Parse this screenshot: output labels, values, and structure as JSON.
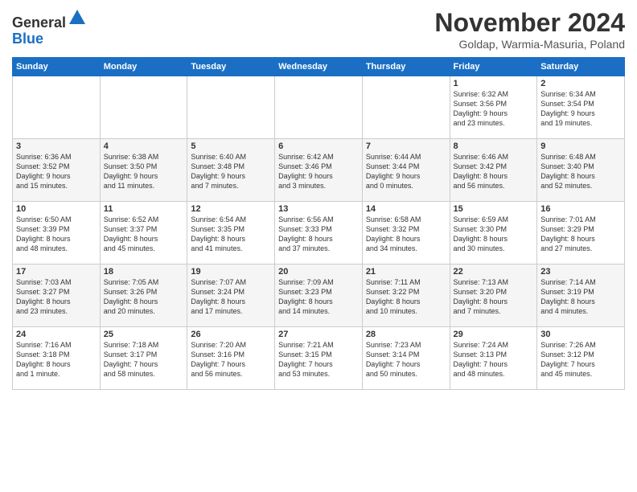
{
  "header": {
    "logo_general": "General",
    "logo_blue": "Blue",
    "title": "November 2024",
    "location": "Goldap, Warmia-Masuria, Poland"
  },
  "weekdays": [
    "Sunday",
    "Monday",
    "Tuesday",
    "Wednesday",
    "Thursday",
    "Friday",
    "Saturday"
  ],
  "weeks": [
    [
      {
        "day": "",
        "info": ""
      },
      {
        "day": "",
        "info": ""
      },
      {
        "day": "",
        "info": ""
      },
      {
        "day": "",
        "info": ""
      },
      {
        "day": "",
        "info": ""
      },
      {
        "day": "1",
        "info": "Sunrise: 6:32 AM\nSunset: 3:56 PM\nDaylight: 9 hours\nand 23 minutes."
      },
      {
        "day": "2",
        "info": "Sunrise: 6:34 AM\nSunset: 3:54 PM\nDaylight: 9 hours\nand 19 minutes."
      }
    ],
    [
      {
        "day": "3",
        "info": "Sunrise: 6:36 AM\nSunset: 3:52 PM\nDaylight: 9 hours\nand 15 minutes."
      },
      {
        "day": "4",
        "info": "Sunrise: 6:38 AM\nSunset: 3:50 PM\nDaylight: 9 hours\nand 11 minutes."
      },
      {
        "day": "5",
        "info": "Sunrise: 6:40 AM\nSunset: 3:48 PM\nDaylight: 9 hours\nand 7 minutes."
      },
      {
        "day": "6",
        "info": "Sunrise: 6:42 AM\nSunset: 3:46 PM\nDaylight: 9 hours\nand 3 minutes."
      },
      {
        "day": "7",
        "info": "Sunrise: 6:44 AM\nSunset: 3:44 PM\nDaylight: 9 hours\nand 0 minutes."
      },
      {
        "day": "8",
        "info": "Sunrise: 6:46 AM\nSunset: 3:42 PM\nDaylight: 8 hours\nand 56 minutes."
      },
      {
        "day": "9",
        "info": "Sunrise: 6:48 AM\nSunset: 3:40 PM\nDaylight: 8 hours\nand 52 minutes."
      }
    ],
    [
      {
        "day": "10",
        "info": "Sunrise: 6:50 AM\nSunset: 3:39 PM\nDaylight: 8 hours\nand 48 minutes."
      },
      {
        "day": "11",
        "info": "Sunrise: 6:52 AM\nSunset: 3:37 PM\nDaylight: 8 hours\nand 45 minutes."
      },
      {
        "day": "12",
        "info": "Sunrise: 6:54 AM\nSunset: 3:35 PM\nDaylight: 8 hours\nand 41 minutes."
      },
      {
        "day": "13",
        "info": "Sunrise: 6:56 AM\nSunset: 3:33 PM\nDaylight: 8 hours\nand 37 minutes."
      },
      {
        "day": "14",
        "info": "Sunrise: 6:58 AM\nSunset: 3:32 PM\nDaylight: 8 hours\nand 34 minutes."
      },
      {
        "day": "15",
        "info": "Sunrise: 6:59 AM\nSunset: 3:30 PM\nDaylight: 8 hours\nand 30 minutes."
      },
      {
        "day": "16",
        "info": "Sunrise: 7:01 AM\nSunset: 3:29 PM\nDaylight: 8 hours\nand 27 minutes."
      }
    ],
    [
      {
        "day": "17",
        "info": "Sunrise: 7:03 AM\nSunset: 3:27 PM\nDaylight: 8 hours\nand 23 minutes."
      },
      {
        "day": "18",
        "info": "Sunrise: 7:05 AM\nSunset: 3:26 PM\nDaylight: 8 hours\nand 20 minutes."
      },
      {
        "day": "19",
        "info": "Sunrise: 7:07 AM\nSunset: 3:24 PM\nDaylight: 8 hours\nand 17 minutes."
      },
      {
        "day": "20",
        "info": "Sunrise: 7:09 AM\nSunset: 3:23 PM\nDaylight: 8 hours\nand 14 minutes."
      },
      {
        "day": "21",
        "info": "Sunrise: 7:11 AM\nSunset: 3:22 PM\nDaylight: 8 hours\nand 10 minutes."
      },
      {
        "day": "22",
        "info": "Sunrise: 7:13 AM\nSunset: 3:20 PM\nDaylight: 8 hours\nand 7 minutes."
      },
      {
        "day": "23",
        "info": "Sunrise: 7:14 AM\nSunset: 3:19 PM\nDaylight: 8 hours\nand 4 minutes."
      }
    ],
    [
      {
        "day": "24",
        "info": "Sunrise: 7:16 AM\nSunset: 3:18 PM\nDaylight: 8 hours\nand 1 minute."
      },
      {
        "day": "25",
        "info": "Sunrise: 7:18 AM\nSunset: 3:17 PM\nDaylight: 7 hours\nand 58 minutes."
      },
      {
        "day": "26",
        "info": "Sunrise: 7:20 AM\nSunset: 3:16 PM\nDaylight: 7 hours\nand 56 minutes."
      },
      {
        "day": "27",
        "info": "Sunrise: 7:21 AM\nSunset: 3:15 PM\nDaylight: 7 hours\nand 53 minutes."
      },
      {
        "day": "28",
        "info": "Sunrise: 7:23 AM\nSunset: 3:14 PM\nDaylight: 7 hours\nand 50 minutes."
      },
      {
        "day": "29",
        "info": "Sunrise: 7:24 AM\nSunset: 3:13 PM\nDaylight: 7 hours\nand 48 minutes."
      },
      {
        "day": "30",
        "info": "Sunrise: 7:26 AM\nSunset: 3:12 PM\nDaylight: 7 hours\nand 45 minutes."
      }
    ]
  ]
}
